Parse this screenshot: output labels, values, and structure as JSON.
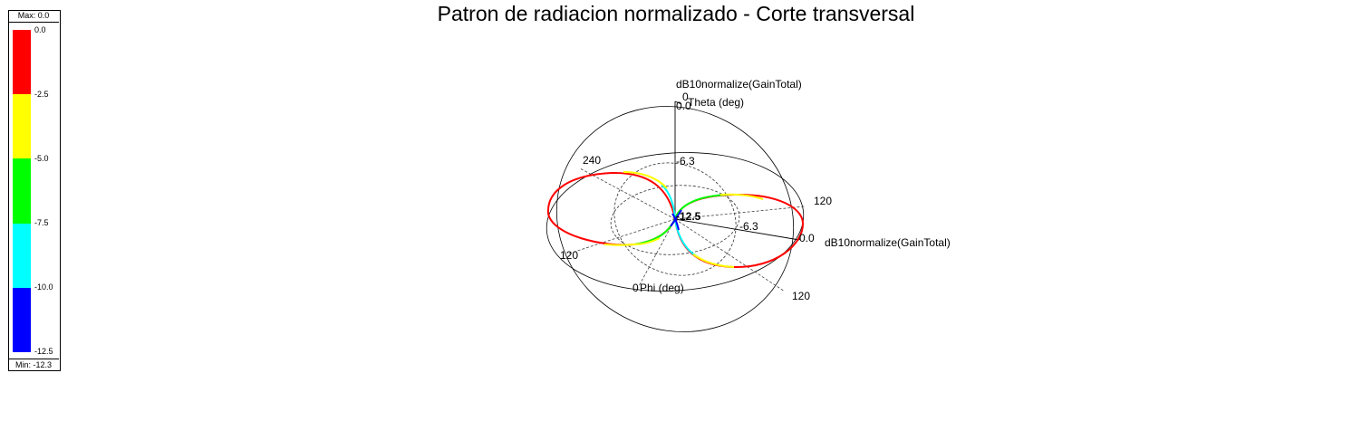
{
  "chart_data": {
    "type": "3d-polar-cut",
    "title": "Patron de radiacion normalizado - Corte transversal",
    "quantity": "dB10normalize(GainTotal)",
    "radial_scale_db": [
      0.0,
      -6.3,
      -12.5
    ],
    "theta_axis_label": "Theta (deg)",
    "phi_axis_label": "Phi (deg)",
    "theta_ticks": [
      "0",
      "240",
      "120"
    ],
    "phi_ticks": [
      "120",
      "120",
      "0"
    ],
    "radial_tick_labels": [
      "0.0",
      "-6.3",
      "-12.5",
      "-6.3",
      "0.0"
    ],
    "max_label": "Max: 0.0",
    "min_label": "Min: -12.3",
    "colorbar": {
      "ticks": [
        "0.0",
        "-2.5",
        "-5.0",
        "-7.5",
        "-10.0",
        "-12.5"
      ],
      "colors": [
        "#ff0000",
        "#ffff00",
        "#00ff00",
        "#00ffff",
        "#0000ff"
      ]
    },
    "pattern": {
      "shape": "figure-eight (two lobes)",
      "max_db": 0.0,
      "min_db": -12.3
    }
  }
}
